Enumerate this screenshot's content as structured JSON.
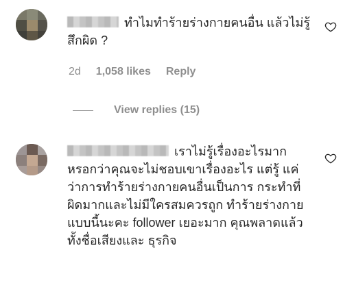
{
  "comments": [
    {
      "text": "ทำไมทำร้ายร่างกายคนอื่น แล้วไม่รู้สึกผิด ?",
      "time": "2d",
      "likes": "1,058 likes",
      "reply_label": "Reply",
      "view_replies": "View replies (15)"
    },
    {
      "text": "เราไม่รู้เรื่องอะไรมาก หรอกว่าคุณจะไม่ชอบเขาเรื่องอะไร แต่รู้ แค่ว่าการทำร้ายร่างกายคนอื่นเป็นการ กระทำที่ผิดมากและไม่มีใครสมควรถูก ทำร้ายร่างกายแบบนี้นะคะ follower เยอะมาก คุณพลาดแล้ว ทั้งชื่อเสียงและ ธุรกิจ"
    }
  ],
  "icons": {
    "like": "heart-outline-icon"
  },
  "colors": {
    "text": "#262626",
    "muted": "#8e8e8e"
  }
}
